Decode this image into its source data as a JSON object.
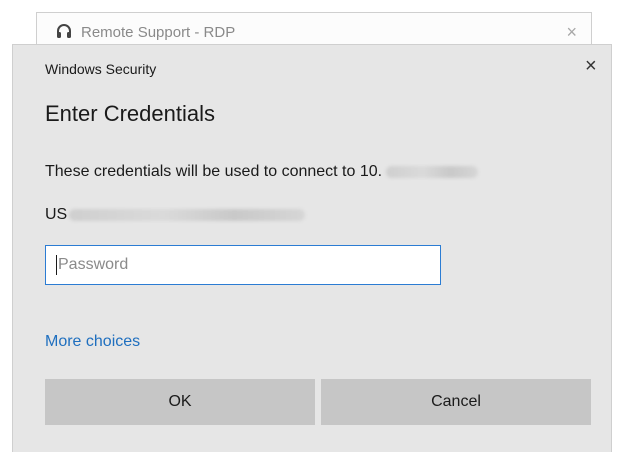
{
  "background_window": {
    "title": "Remote Support - RDP",
    "icon": "headset-icon",
    "close_glyph": "×"
  },
  "dialog": {
    "window_label": "Windows Security",
    "close_glyph": "×",
    "heading": "Enter Credentials",
    "description": "These credentials will be used to connect to 10.",
    "username_prefix": "US",
    "password_placeholder": "Password",
    "more_choices": "More choices",
    "ok_label": "OK",
    "cancel_label": "Cancel"
  },
  "colors": {
    "dialog_bg": "#e6e6e6",
    "button_bg": "#c6c6c6",
    "link": "#1f6fbf",
    "input_border": "#2b7cd3"
  }
}
